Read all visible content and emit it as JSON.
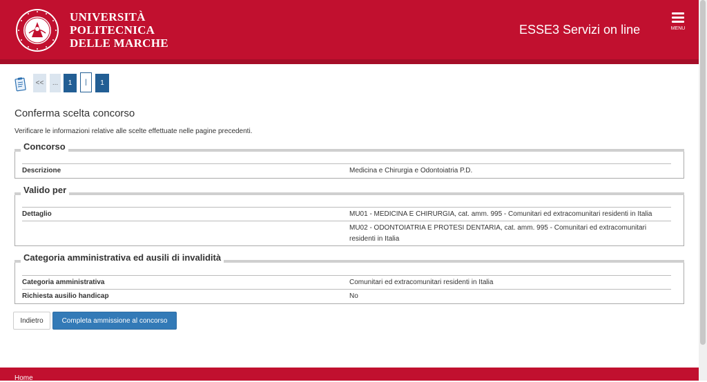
{
  "header": {
    "university_lines": [
      "UNIVERSITÀ",
      "POLITECNICA",
      "DELLE MARCHE"
    ],
    "seal_text": "UNIVERSITÀ POLITECNICA DELLE MARCHE",
    "app_title": "ESSE3 Servizi on line",
    "menu_label": "MENU"
  },
  "navigation": {
    "icon": "clipboard-icon",
    "steps": [
      "<<",
      "...",
      "1",
      "|",
      "1"
    ],
    "current_step_index": 3
  },
  "page": {
    "title": "Conferma scelta concorso",
    "description": "Verificare le informazioni relative alle scelte effettuate nelle pagine precedenti."
  },
  "sections": {
    "concorso": {
      "legend": "Concorso",
      "rows": [
        {
          "label": "Descrizione",
          "value": "Medicina e Chirurgia e Odontoiatria P.D."
        }
      ]
    },
    "valido_per": {
      "legend": "Valido per",
      "rows": [
        {
          "label": "Dettaglio",
          "value": "MU01 - MEDICINA E CHIRURGIA, cat. amm. 995 - Comunitari ed extracomunitari residenti in Italia"
        },
        {
          "label": "",
          "value": "MU02 - ODONTOIATRIA E PROTESI DENTARIA, cat. amm. 995 - Comunitari ed extracomunitari residenti in Italia"
        }
      ]
    },
    "categoria": {
      "legend": "Categoria amministrativa ed ausili di invalidità",
      "rows": [
        {
          "label": "Categoria amministrativa",
          "value": "Comunitari ed extracomunitari residenti in Italia"
        },
        {
          "label": "Richiesta ausilio handicap",
          "value": "No"
        }
      ]
    }
  },
  "buttons": {
    "back": "Indietro",
    "confirm": "Completa ammissione al concorso"
  },
  "footer": {
    "home_link": "Home"
  },
  "colors": {
    "brand_red": "#c1102f",
    "nav_blue": "#225e94",
    "button_blue": "#337ab7"
  }
}
